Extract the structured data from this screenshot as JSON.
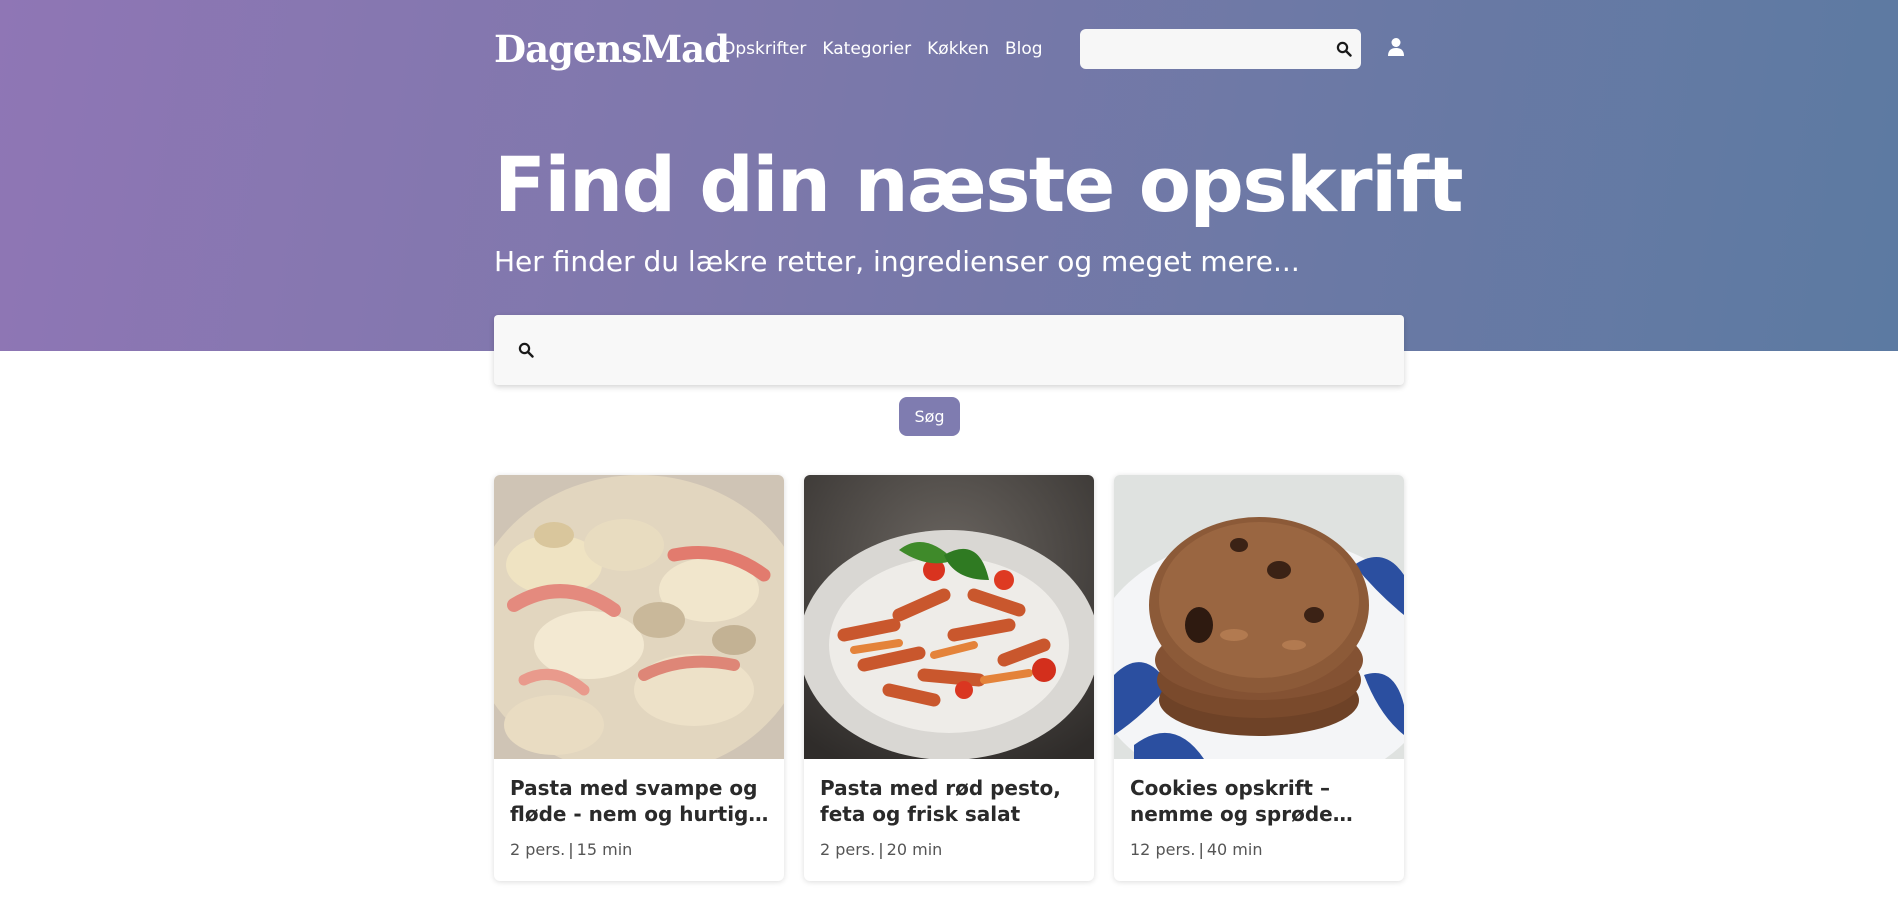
{
  "header": {
    "logo": "DagensMad",
    "nav": [
      "Opskrifter",
      "Kategorier",
      "Køkken",
      "Blog"
    ],
    "search_placeholder": "",
    "search_icon": "search-icon",
    "user_icon": "user-icon"
  },
  "hero": {
    "title": "Find din næste opskrift",
    "subtitle": "Her finder du lækre retter, ingredienser og meget mere..."
  },
  "search": {
    "placeholder": "",
    "icon": "search-icon",
    "button_label": "Søg",
    "button_color": "#7f7cb0"
  },
  "recipes": [
    {
      "title": "Pasta med svampe og fløde - nem og hurtig aftensmad",
      "persons": "2 pers.",
      "time": "15 min",
      "image": "pasta-with-mushrooms-and-cream-photo"
    },
    {
      "title": "Pasta med rød pesto, feta og frisk salat",
      "persons": "2 pers.",
      "time": "20 min",
      "image": "penne-with-red-pesto-photo"
    },
    {
      "title": "Cookies opskrift – nemme og sprøde cookies med chokolade",
      "persons": "12 pers.",
      "time": "40 min",
      "image": "stacked-chocolate-cookies-photo"
    }
  ],
  "colors": {
    "hero_gradient_start": "#8f76b5",
    "hero_gradient_end": "#5c7aa2"
  }
}
